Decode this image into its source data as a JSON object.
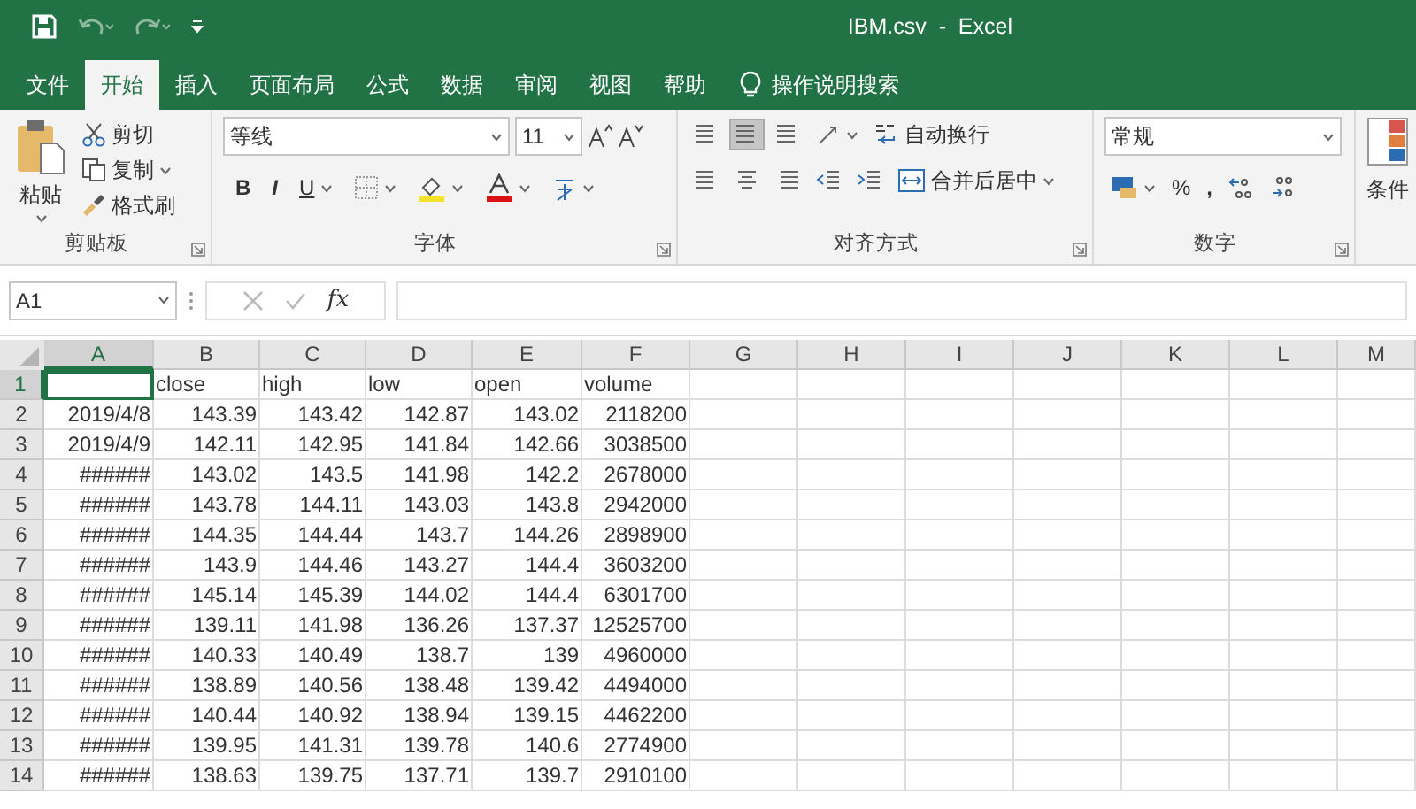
{
  "window": {
    "title": "IBM.csv  -  Excel"
  },
  "tabs": [
    {
      "label": "文件",
      "selected": false
    },
    {
      "label": "开始",
      "selected": true
    },
    {
      "label": "插入",
      "selected": false
    },
    {
      "label": "页面布局",
      "selected": false
    },
    {
      "label": "公式",
      "selected": false
    },
    {
      "label": "数据",
      "selected": false
    },
    {
      "label": "审阅",
      "selected": false
    },
    {
      "label": "视图",
      "selected": false
    },
    {
      "label": "帮助",
      "selected": false
    }
  ],
  "tell_me": {
    "label": "操作说明搜索"
  },
  "ribbon": {
    "clipboard": {
      "title": "剪贴板",
      "paste": "粘贴",
      "cut": "剪切",
      "copy": "复制",
      "format_painter": "格式刷"
    },
    "font": {
      "title": "字体",
      "font_name": "等线",
      "font_size": "11",
      "bold": "B",
      "italic": "I",
      "underline": "U"
    },
    "alignment": {
      "title": "对齐方式",
      "wrap_text": "自动换行",
      "merge_center": "合并后居中",
      "vertical_align": [
        {
          "selected": false
        },
        {
          "selected": true
        },
        {
          "selected": false
        }
      ]
    },
    "number": {
      "title": "数字",
      "format": "常规",
      "percent": "%",
      "comma": ","
    },
    "styles": {
      "label": "条件"
    }
  },
  "formula_bar": {
    "name_box": "A1",
    "function_label": "fx"
  },
  "sheet": {
    "columns": [
      {
        "label": "A",
        "selected": true
      },
      {
        "label": "B",
        "selected": false
      },
      {
        "label": "C",
        "selected": false
      },
      {
        "label": "D",
        "selected": false
      },
      {
        "label": "E",
        "selected": false
      },
      {
        "label": "F",
        "selected": false
      },
      {
        "label": "G",
        "selected": false
      },
      {
        "label": "H",
        "selected": false
      },
      {
        "label": "I",
        "selected": false
      },
      {
        "label": "J",
        "selected": false
      },
      {
        "label": "K",
        "selected": false
      },
      {
        "label": "L",
        "selected": false
      },
      {
        "label": "M",
        "selected": false
      }
    ],
    "rows": [
      {
        "number": "1",
        "selected": true,
        "kind": "text",
        "cells": [
          null,
          "close",
          "high",
          "low",
          "open",
          "volume"
        ]
      },
      {
        "number": "2",
        "selected": false,
        "kind": "number",
        "cells": [
          "2019/4/8",
          "143.39",
          "143.42",
          "142.87",
          "143.02",
          "2118200"
        ]
      },
      {
        "number": "3",
        "selected": false,
        "kind": "number",
        "cells": [
          "2019/4/9",
          "142.11",
          "142.95",
          "141.84",
          "142.66",
          "3038500"
        ]
      },
      {
        "number": "4",
        "selected": false,
        "kind": "number",
        "cells": [
          "######",
          "143.02",
          "143.5",
          "141.98",
          "142.2",
          "2678000"
        ]
      },
      {
        "number": "5",
        "selected": false,
        "kind": "number",
        "cells": [
          "######",
          "143.78",
          "144.11",
          "143.03",
          "143.8",
          "2942000"
        ]
      },
      {
        "number": "6",
        "selected": false,
        "kind": "number",
        "cells": [
          "######",
          "144.35",
          "144.44",
          "143.7",
          "144.26",
          "2898900"
        ]
      },
      {
        "number": "7",
        "selected": false,
        "kind": "number",
        "cells": [
          "######",
          "143.9",
          "144.46",
          "143.27",
          "144.4",
          "3603200"
        ]
      },
      {
        "number": "8",
        "selected": false,
        "kind": "number",
        "cells": [
          "######",
          "145.14",
          "145.39",
          "144.02",
          "144.4",
          "6301700"
        ]
      },
      {
        "number": "9",
        "selected": false,
        "kind": "number",
        "cells": [
          "######",
          "139.11",
          "141.98",
          "136.26",
          "137.37",
          "12525700"
        ]
      },
      {
        "number": "10",
        "selected": false,
        "kind": "number",
        "cells": [
          "######",
          "140.33",
          "140.49",
          "138.7",
          "139",
          "4960000"
        ]
      },
      {
        "number": "11",
        "selected": false,
        "kind": "number",
        "cells": [
          "######",
          "138.89",
          "140.56",
          "138.48",
          "139.42",
          "4494000"
        ]
      },
      {
        "number": "12",
        "selected": false,
        "kind": "number",
        "cells": [
          "######",
          "140.44",
          "140.92",
          "138.94",
          "139.15",
          "4462200"
        ]
      },
      {
        "number": "13",
        "selected": false,
        "kind": "number",
        "cells": [
          "######",
          "139.95",
          "141.31",
          "139.78",
          "140.6",
          "2774900"
        ]
      },
      {
        "number": "14",
        "selected": false,
        "kind": "number",
        "cells": [
          "######",
          "138.63",
          "139.75",
          "137.71",
          "139.7",
          "2910100"
        ]
      }
    ]
  }
}
